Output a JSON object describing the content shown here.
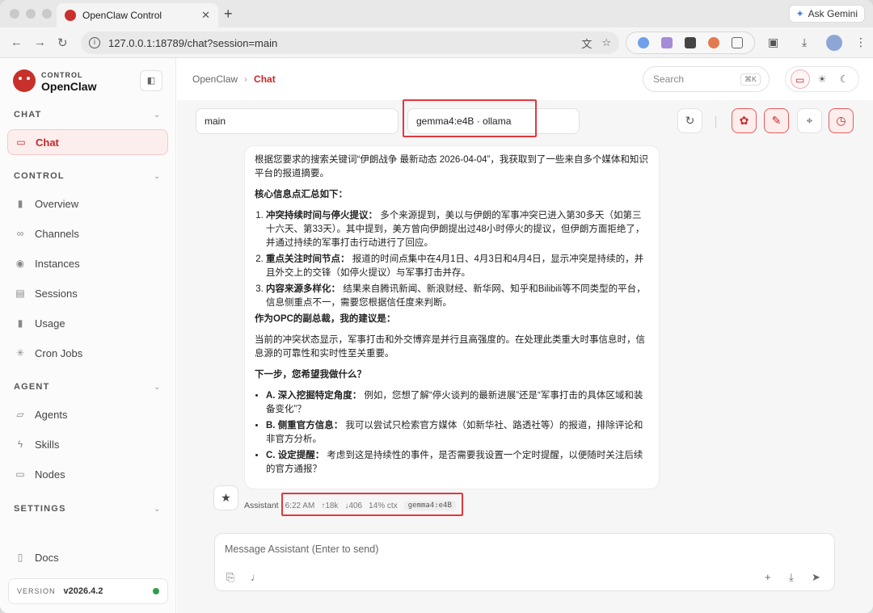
{
  "browser": {
    "tab_title": "OpenClaw Control",
    "tab_close": "✕",
    "new_tab": "+",
    "ask_gemini": "Ask Gemini",
    "url": "127.0.0.1:18789/chat?session=main"
  },
  "sidebar": {
    "brand_sub": "CONTROL",
    "brand_main": "OpenClaw",
    "sections": {
      "chat": "CHAT",
      "control": "CONTROL",
      "agent": "AGENT",
      "settings": "SETTINGS"
    },
    "chat_items": [
      {
        "label": "Chat",
        "icon": "chat-bubble-icon",
        "active": true
      }
    ],
    "control_items": [
      {
        "label": "Overview",
        "icon": "bar-chart-icon"
      },
      {
        "label": "Channels",
        "icon": "link-icon"
      },
      {
        "label": "Instances",
        "icon": "broadcast-icon"
      },
      {
        "label": "Sessions",
        "icon": "document-icon"
      },
      {
        "label": "Usage",
        "icon": "bar-chart-icon"
      },
      {
        "label": "Cron Jobs",
        "icon": "loader-icon"
      }
    ],
    "agent_items": [
      {
        "label": "Agents",
        "icon": "folder-icon"
      },
      {
        "label": "Skills",
        "icon": "lightning-icon"
      },
      {
        "label": "Nodes",
        "icon": "monitor-icon"
      }
    ],
    "docs": "Docs",
    "version_label": "VERSION",
    "version_value": "v2026.4.2"
  },
  "header": {
    "breadcrumb_root": "OpenClaw",
    "breadcrumb_sep": "›",
    "breadcrumb_current": "Chat",
    "search_placeholder": "Search",
    "search_shortcut": "⌘K"
  },
  "chat": {
    "session_select": "main",
    "model_select": "gemma4:e4B · ollama",
    "message": {
      "intro": "根据您要求的搜索关键词“伊朗战争 最新动态 2026-04-04”，我获取到了一些来自多个媒体和知识平台的报道摘要。",
      "summary_heading": "核心信息点汇总如下：",
      "points": [
        {
          "title": "冲突持续时间与停火提议：",
          "text": " 多个来源提到，美以与伊朗的军事冲突已进入第30多天（如第三十六天、第33天）。其中提到，美方曾向伊朗提出过48小时停火的提议，但伊朗方面拒绝了，并通过持续的军事打击行动进行了回应。"
        },
        {
          "title": "重点关注时间节点：",
          "text": " 报道的时间点集中在4月1日、4月3日和4月4日，显示冲突是持续的，并且外交上的交锋（如停火提议）与军事打击并存。"
        },
        {
          "title": "内容来源多样化：",
          "text": " 结果来自腾讯新闻、新浪财经、新华网、知乎和Bilibili等不同类型的平台，信息侧重点不一，需要您根据信任度来判断。"
        }
      ],
      "advice_heading": "作为OPC的副总裁，我的建议是：",
      "advice": "当前的冲突状态显示，军事打击和外交博弈是并行且高强度的。在处理此类重大时事信息时，信息源的可靠性和实时性至关重要。",
      "next_heading": "下一步，您希望我做什么？",
      "options": [
        {
          "title": "A. 深入挖掘特定角度：",
          "text": " 例如，您想了解“停火谈判的最新进展”还是“军事打击的具体区域和装备变化”？"
        },
        {
          "title": "B. 侧重官方信息：",
          "text": " 我可以尝试只检索官方媒体（如新华社、路透社等）的报道，排除评论和非官方分析。"
        },
        {
          "title": "C. 设定提醒：",
          "text": " 考虑到这是持续性的事件，是否需要我设置一个定时提醒，以便随时关注后续的官方通报？"
        }
      ]
    },
    "meta": {
      "sender": "Assistant",
      "time": "6:22 AM",
      "tokens_in": "↑18k",
      "tokens_out": "↓406",
      "ctx": "14% ctx",
      "model": "gemma4:e4B"
    },
    "composer_placeholder": "Message Assistant (Enter to send)"
  },
  "colors": {
    "accent": "#c62828",
    "highlight": "#e0393f",
    "status_online": "#2e9d4a"
  }
}
